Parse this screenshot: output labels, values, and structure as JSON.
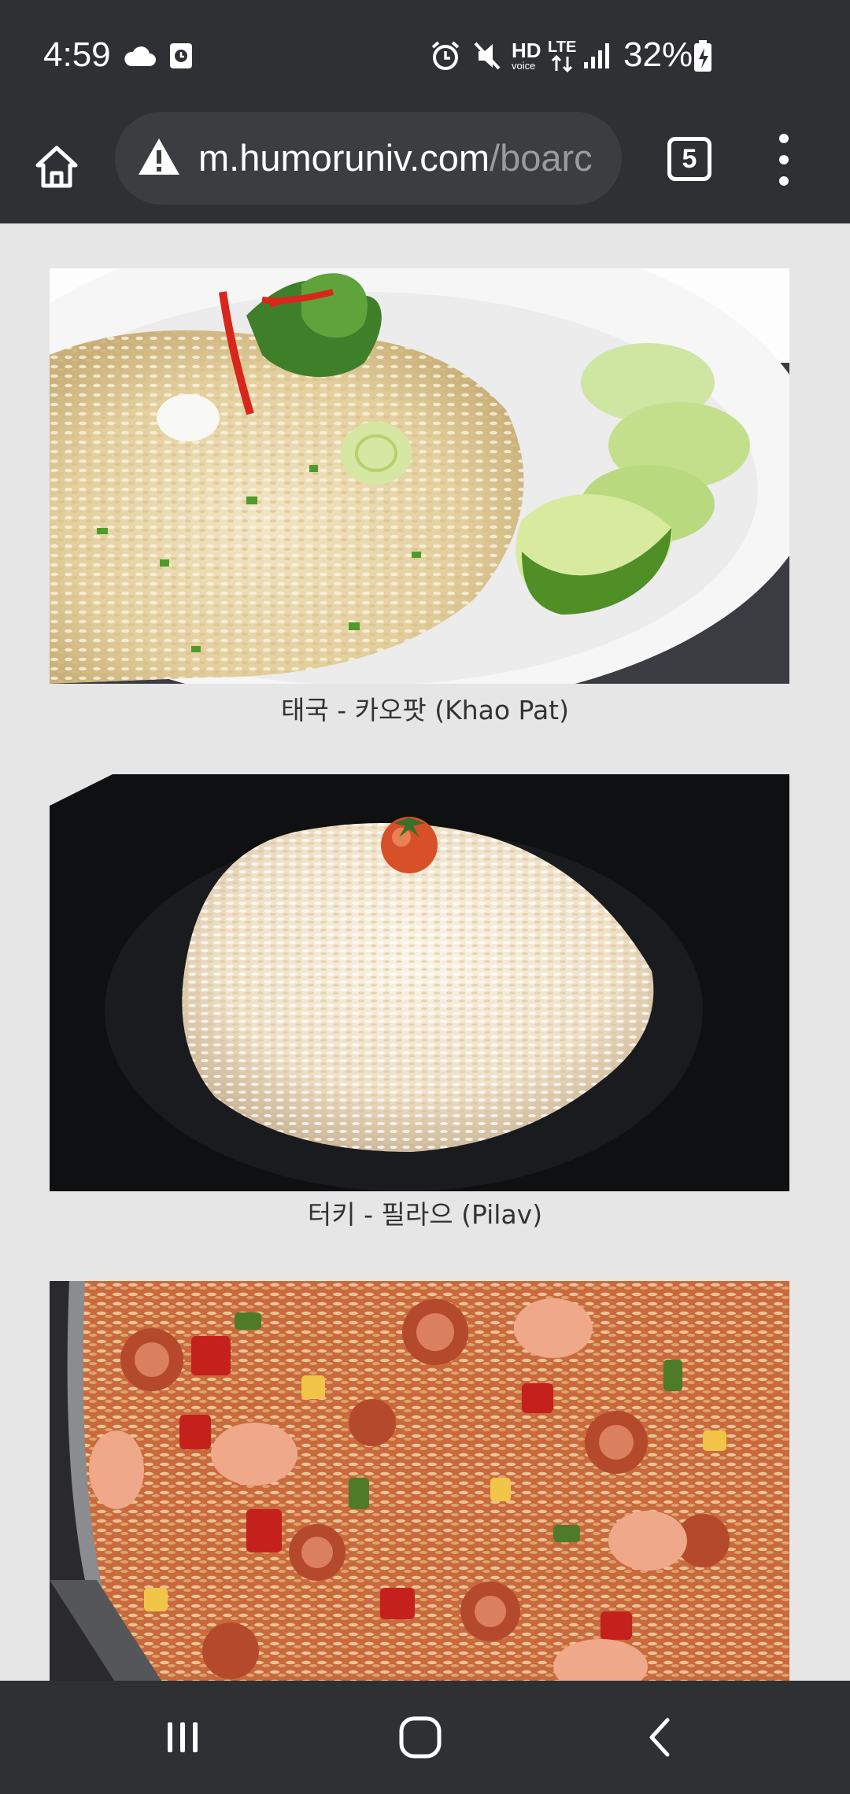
{
  "status_bar": {
    "time": "4:59",
    "battery": "32%",
    "left_icons": [
      "cloud-icon",
      "clock-notification-icon"
    ],
    "right_icons": [
      "alarm-icon",
      "mute-icon",
      "hd-voice-icon",
      "lte-icon",
      "signal-icon",
      "battery-charging-icon"
    ],
    "hd_label": "HD",
    "voice_label": "voice",
    "lte_label": "LTE"
  },
  "toolbar": {
    "url_host": "m.humoruniv.com",
    "url_path": "/boarc",
    "tab_count": "5",
    "icons": [
      "home-icon",
      "warning-icon",
      "tabs-icon",
      "more-vert-icon"
    ]
  },
  "posts": [
    {
      "caption": "태국 - 카오팟 (Khao Pat)",
      "image": "fried-rice-photo"
    },
    {
      "caption": "터키 - 필라으 (Pilav)",
      "image": "pilav-photo"
    },
    {
      "caption": "",
      "image": "jambalaya-photo"
    }
  ],
  "nav_bar": {
    "icons": [
      "recents-icon",
      "home-nav-icon",
      "back-icon"
    ]
  },
  "colors": {
    "system_bar": "#2f3033",
    "url_field": "#3c3d41",
    "page_background": "#e6e6e6"
  }
}
